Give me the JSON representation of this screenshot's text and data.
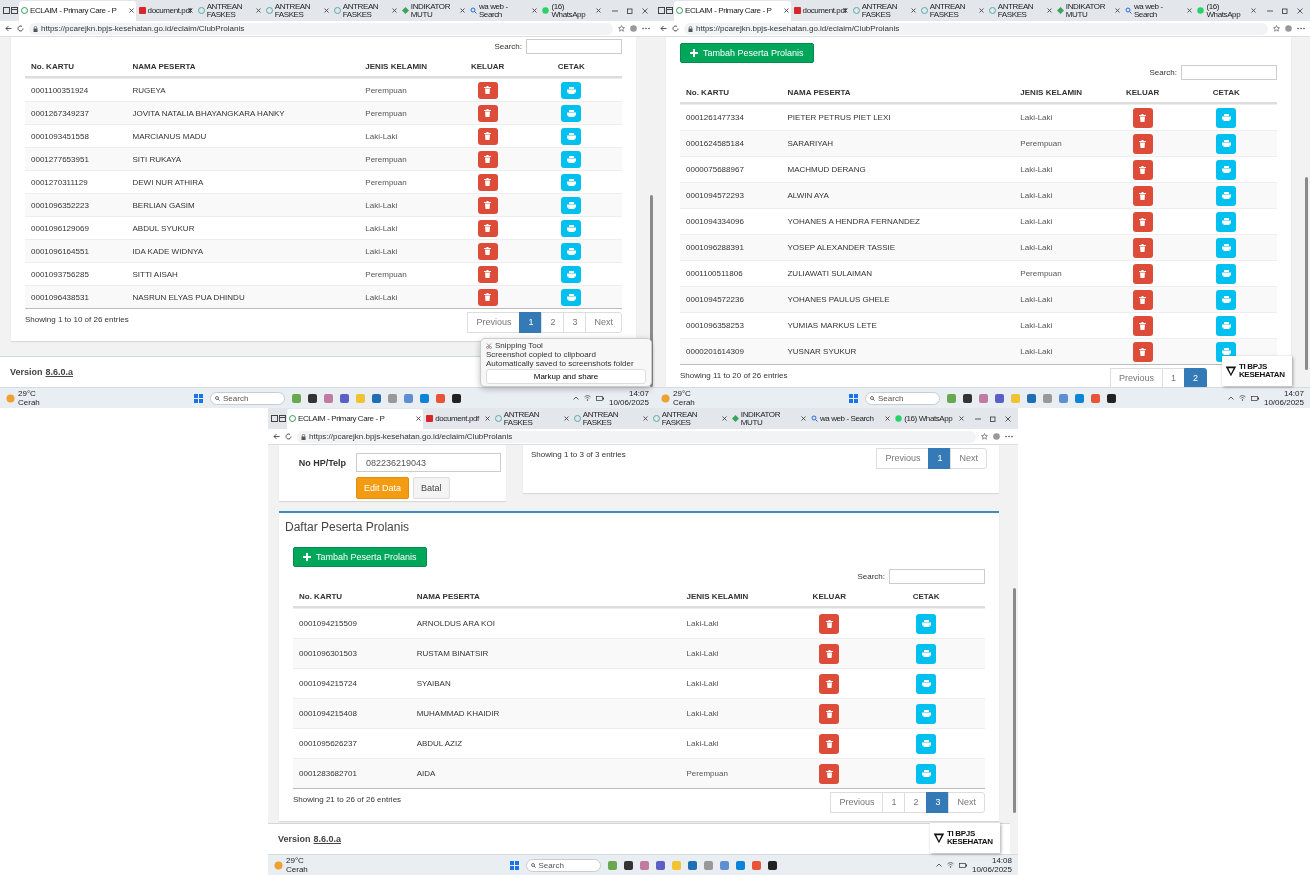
{
  "screens": [
    {
      "browser_tabs": [
        {
          "label": "ECLAIM - Primary Care - P",
          "selected": true
        },
        {
          "label": "document.pdf",
          "selected": false
        },
        {
          "label": "ANTREAN FASKES",
          "selected": false
        },
        {
          "label": "ANTREAN FASKES",
          "selected": false
        },
        {
          "label": "ANTREAN FASKES",
          "selected": false
        },
        {
          "label": "INDIKATOR MUTU",
          "selected": false
        },
        {
          "label": "wa web - Search",
          "selected": false
        },
        {
          "label": "(16) WhatsApp",
          "selected": false
        }
      ],
      "url": "https://pcarejkn.bpjs-kesehatan.go.id/eclaim/ClubProlanis",
      "blocks": [
        {
          "kind": "table_panel",
          "search_label": "Search:",
          "columns": [
            "No. KARTU",
            "NAMA PESERTA",
            "JENIS KELAMIN",
            "KELUAR",
            "CETAK"
          ],
          "rows": [
            {
              "card_no": "0001100351924",
              "name": "RUGEYA",
              "gender": "Perempuan"
            },
            {
              "card_no": "0001267349237",
              "name": "JOVITA NATALIA BHAYANGKARA HANKY",
              "gender": "Perempuan"
            },
            {
              "card_no": "0001093451558",
              "name": "MARCIANUS MADU",
              "gender": "Laki-Laki"
            },
            {
              "card_no": "0001277653951",
              "name": "SITI RUKAYA",
              "gender": "Perempuan"
            },
            {
              "card_no": "0001270311129",
              "name": "DEWI NUR ATHIRA",
              "gender": "Perempuan"
            },
            {
              "card_no": "0001096352223",
              "name": "BERLIAN GASIM",
              "gender": "Laki-Laki"
            },
            {
              "card_no": "0001096129069",
              "name": "ABDUL SYUKUR",
              "gender": "Laki-Laki"
            },
            {
              "card_no": "0001096164551",
              "name": "IDA KADE WIDNYA",
              "gender": "Laki-Laki"
            },
            {
              "card_no": "0001093756285",
              "name": "SITTI AISAH",
              "gender": "Perempuan"
            },
            {
              "card_no": "0001096438531",
              "name": "NASRUN ELYAS PUA DHINDU",
              "gender": "Laki-Laki"
            }
          ],
          "info": "Showing 1 to 10 of 26 entries",
          "pages": [
            {
              "label": "Previous",
              "selected": false
            },
            {
              "label": "1",
              "selected": true
            },
            {
              "label": "2",
              "selected": false
            },
            {
              "label": "3",
              "selected": false
            },
            {
              "label": "Next",
              "selected": false
            }
          ]
        },
        {
          "kind": "footer",
          "version_label": "Version",
          "version": "8.6.0.a"
        }
      ],
      "notification": {
        "app": "Snipping Tool",
        "title": "Screenshot copied to clipboard",
        "body": "Automatically saved to screenshots folder",
        "action": "Markup and share"
      },
      "taskbar": {
        "temperature": "29°C",
        "weather": "Cerah",
        "search": "Search",
        "time": "14:07",
        "date": "10/06/2025"
      }
    },
    {
      "browser_tabs": [
        {
          "label": "ECLAIM - Primary Care - P",
          "selected": true
        },
        {
          "label": "document.pdf",
          "selected": false
        },
        {
          "label": "ANTREAN FASKES",
          "selected": false
        },
        {
          "label": "ANTREAN FASKES",
          "selected": false
        },
        {
          "label": "ANTREAN FASKES",
          "selected": false
        },
        {
          "label": "INDIKATOR MUTU",
          "selected": false
        },
        {
          "label": "wa web - Search",
          "selected": false
        },
        {
          "label": "(16) WhatsApp",
          "selected": false
        }
      ],
      "url": "https://pcarejkn.bpjs-kesehatan.go.id/eclaim/ClubProlanis",
      "blocks": [
        {
          "kind": "table_panel",
          "add_button": "Tambah Peserta Prolanis",
          "search_label": "Search:",
          "columns": [
            "No. KARTU",
            "NAMA PESERTA",
            "JENIS KELAMIN",
            "KELUAR",
            "CETAK"
          ],
          "rows": [
            {
              "card_no": "0001261477334",
              "name": "PIETER PETRUS PIET LEXI",
              "gender": "Laki-Laki"
            },
            {
              "card_no": "0001624585184",
              "name": "SARARIYAH",
              "gender": "Perempuan"
            },
            {
              "card_no": "0000075688967",
              "name": "MACHMUD DERANG",
              "gender": "Laki-Laki"
            },
            {
              "card_no": "0001094572293",
              "name": "ALWIN AYA",
              "gender": "Laki-Laki"
            },
            {
              "card_no": "0001094334096",
              "name": "YOHANES A HENDRA FERNANDEZ",
              "gender": "Laki-Laki"
            },
            {
              "card_no": "0001096288391",
              "name": "YOSEP ALEXANDER TASSIE",
              "gender": "Laki-Laki"
            },
            {
              "card_no": "0001100511806",
              "name": "ZULIAWATI SULAIMAN",
              "gender": "Perempuan"
            },
            {
              "card_no": "0001094572236",
              "name": "YOHANES PAULUS GHELE",
              "gender": "Laki-Laki"
            },
            {
              "card_no": "0001096358253",
              "name": "YUMIAS MARKUS LETE",
              "gender": "Laki-Laki"
            },
            {
              "card_no": "0000201614309",
              "name": "YUSNAR SYUKUR",
              "gender": "Laki-Laki"
            }
          ],
          "info": "Showing 11 to 20 of 26 entries",
          "pages": [
            {
              "label": "Previous",
              "selected": false
            },
            {
              "label": "1",
              "selected": false
            },
            {
              "label": "2",
              "selected": true
            }
          ]
        }
      ],
      "logo": {
        "text": "TI BPJS KESEHATAN"
      },
      "taskbar": {
        "temperature": "29°C",
        "weather": "Cerah",
        "search": "Search",
        "time": "14:07",
        "date": "10/06/2025"
      }
    },
    {
      "browser_tabs": [
        {
          "label": "ECLAIM - Primary Care - P",
          "selected": true
        },
        {
          "label": "document.pdf",
          "selected": false
        },
        {
          "label": "ANTREAN FASKES",
          "selected": false
        },
        {
          "label": "ANTREAN FASKES",
          "selected": false
        },
        {
          "label": "ANTREAN FASKES",
          "selected": false
        },
        {
          "label": "INDIKATOR MUTU",
          "selected": false
        },
        {
          "label": "wa web - Search",
          "selected": false
        },
        {
          "label": "(16) WhatsApp",
          "selected": false
        }
      ],
      "url": "https://pcarejkn.bpjs-kesehatan.go.id/eclaim/ClubProlanis",
      "blocks": [
        {
          "kind": "form_and_pager",
          "form": {
            "label": "No HP/Telp",
            "value": "082236219043",
            "save_button": "Edit Data",
            "cancel_button": "Batal"
          },
          "pager_card": {
            "info": "Showing 1 to 3 of 3 entries",
            "pages": [
              {
                "label": "Previous",
                "selected": false
              },
              {
                "label": "1",
                "selected": true
              },
              {
                "label": "Next",
                "selected": false
              }
            ]
          }
        },
        {
          "kind": "table_panel",
          "title": "Daftar Peserta Prolanis",
          "add_button": "Tambah Peserta Prolanis",
          "search_label": "Search:",
          "columns": [
            "No. KARTU",
            "NAMA PESERTA",
            "JENIS KELAMIN",
            "KELUAR",
            "CETAK"
          ],
          "rows": [
            {
              "card_no": "0001094215509",
              "name": "ARNOLDUS ARA KOI",
              "gender": "Laki-Laki"
            },
            {
              "card_no": "0001096301503",
              "name": "RUSTAM BINATSIR",
              "gender": "Laki-Laki"
            },
            {
              "card_no": "0001094215724",
              "name": "SYAIBAN",
              "gender": "Laki-Laki"
            },
            {
              "card_no": "0001094215408",
              "name": "MUHAMMAD KHAIDIR",
              "gender": "Laki-Laki"
            },
            {
              "card_no": "0001095626237",
              "name": "ABDUL AZIZ",
              "gender": "Laki-Laki"
            },
            {
              "card_no": "0001283682701",
              "name": "AIDA",
              "gender": "Perempuan"
            }
          ],
          "info": "Showing 21 to 26 of 26 entries",
          "pages": [
            {
              "label": "Previous",
              "selected": false
            },
            {
              "label": "1",
              "selected": false
            },
            {
              "label": "2",
              "selected": false
            },
            {
              "label": "3",
              "selected": true
            },
            {
              "label": "Next",
              "selected": false
            }
          ]
        },
        {
          "kind": "footer",
          "version_label": "Version",
          "version": "8.6.0.a"
        }
      ],
      "logo": {
        "text": "TI BPJS KESEHATAN"
      },
      "taskbar": {
        "temperature": "29°C",
        "weather": "Cerah",
        "search": "Search",
        "time": "14:08",
        "date": "10/06/2025"
      }
    }
  ]
}
